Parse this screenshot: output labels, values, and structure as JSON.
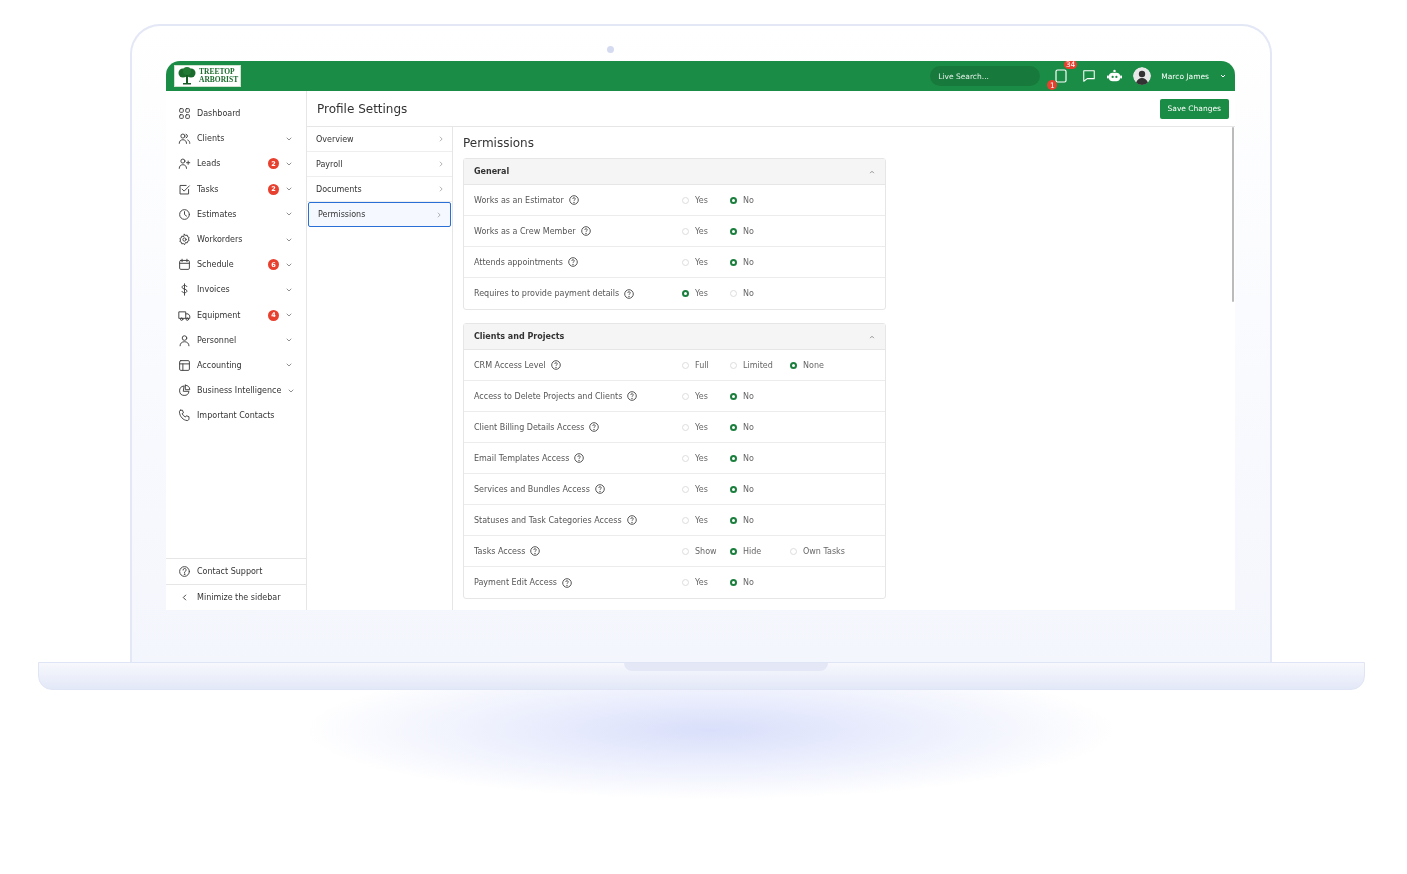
{
  "topbar": {
    "logo": [
      "TREETOP",
      "ARBORIST"
    ],
    "search": {
      "placeholder": "Live Search..."
    },
    "notification_count": "34",
    "alert_count": "1",
    "user": "Marco James"
  },
  "sidebar": {
    "items": [
      {
        "label": "Dashboard",
        "has_submenu": false
      },
      {
        "label": "Clients",
        "has_submenu": true
      },
      {
        "label": "Leads",
        "badge": "2",
        "has_submenu": true
      },
      {
        "label": "Tasks",
        "badge": "2",
        "has_submenu": true
      },
      {
        "label": "Estimates",
        "has_submenu": true
      },
      {
        "label": "Workorders",
        "has_submenu": true
      },
      {
        "label": "Schedule",
        "badge": "6",
        "has_submenu": true
      },
      {
        "label": "Invoices",
        "has_submenu": true
      },
      {
        "label": "Equipment",
        "badge": "4",
        "has_submenu": true
      },
      {
        "label": "Personnel",
        "has_submenu": true
      },
      {
        "label": "Accounting",
        "has_submenu": true
      },
      {
        "label": "Business Intelligence",
        "has_submenu": true
      },
      {
        "label": "Important Contacts",
        "has_submenu": false
      }
    ],
    "footer": [
      "Contact Support",
      "Minimize the sidebar"
    ]
  },
  "header": {
    "title": "Profile Settings",
    "save_button": "Save Changes"
  },
  "subnav": [
    {
      "label": "Overview",
      "selected": false
    },
    {
      "label": "Payroll",
      "selected": false
    },
    {
      "label": "Documents",
      "selected": false
    },
    {
      "label": "Permissions",
      "selected": true
    }
  ],
  "permissions": {
    "title": "Permissions",
    "sections": [
      {
        "title": "General",
        "expanded": true,
        "rows": [
          {
            "label": "Works as an Estimator",
            "options": [
              {
                "label": "Yes",
                "selected": false
              },
              {
                "label": "No",
                "selected": true
              }
            ]
          },
          {
            "label": "Works as a Crew Member",
            "options": [
              {
                "label": "Yes",
                "selected": false
              },
              {
                "label": "No",
                "selected": true
              }
            ]
          },
          {
            "label": "Attends appointments",
            "options": [
              {
                "label": "Yes",
                "selected": false
              },
              {
                "label": "No",
                "selected": true
              }
            ]
          },
          {
            "label": "Requires to provide payment details",
            "options": [
              {
                "label": "Yes",
                "selected": true
              },
              {
                "label": "No",
                "selected": false
              }
            ]
          }
        ]
      },
      {
        "title": "Clients and Projects",
        "expanded": true,
        "rows": [
          {
            "label": "CRM Access Level",
            "options": [
              {
                "label": "Full",
                "selected": false
              },
              {
                "label": "Limited",
                "selected": false
              },
              {
                "label": "None",
                "selected": true
              }
            ]
          },
          {
            "label": "Access to Delete Projects and Clients",
            "options": [
              {
                "label": "Yes",
                "selected": false
              },
              {
                "label": "No",
                "selected": true
              }
            ]
          },
          {
            "label": "Client Billing Details Access",
            "options": [
              {
                "label": "Yes",
                "selected": false
              },
              {
                "label": "No",
                "selected": true
              }
            ]
          },
          {
            "label": "Email Templates Access",
            "options": [
              {
                "label": "Yes",
                "selected": false
              },
              {
                "label": "No",
                "selected": true
              }
            ]
          },
          {
            "label": "Services and Bundles Access",
            "options": [
              {
                "label": "Yes",
                "selected": false
              },
              {
                "label": "No",
                "selected": true
              }
            ]
          },
          {
            "label": "Statuses and Task Categories Access",
            "options": [
              {
                "label": "Yes",
                "selected": false
              },
              {
                "label": "No",
                "selected": true
              }
            ]
          },
          {
            "label": "Tasks Access",
            "options": [
              {
                "label": "Show",
                "selected": false
              },
              {
                "label": "Hide",
                "selected": true
              },
              {
                "label": "Own Tasks",
                "selected": false
              }
            ]
          },
          {
            "label": "Payment Edit Access",
            "options": [
              {
                "label": "Yes",
                "selected": false
              },
              {
                "label": "No",
                "selected": true
              }
            ]
          }
        ]
      }
    ]
  }
}
